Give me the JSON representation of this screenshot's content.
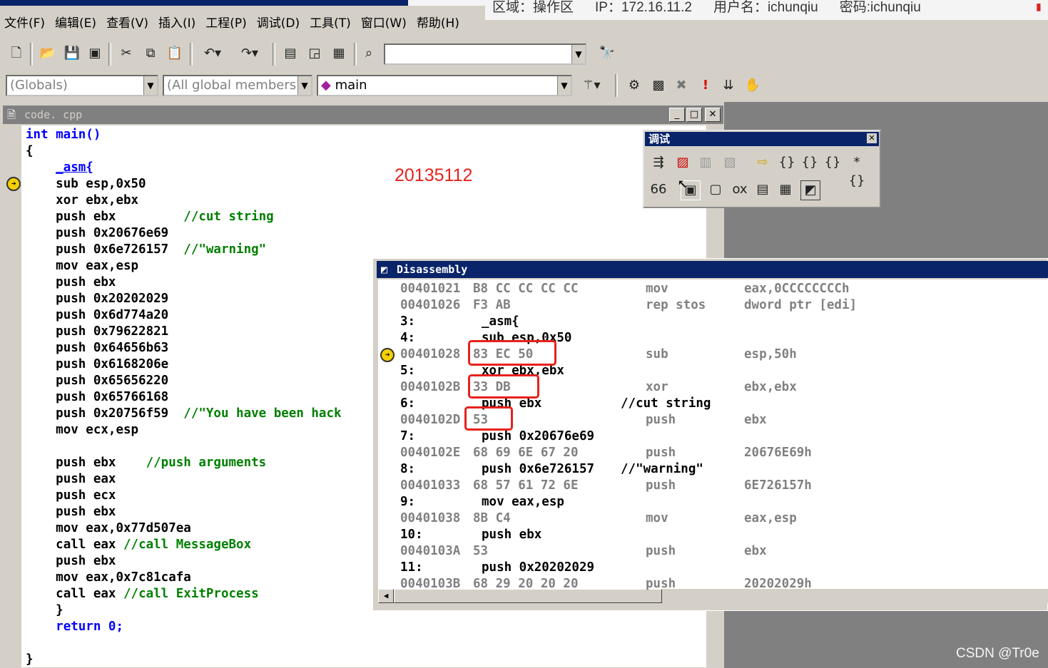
{
  "overlay": {
    "region": "区域：操作区",
    "ip": "IP：172.16.11.2",
    "username": "用户名：ichunqiu",
    "password": "密码:ichunqiu"
  },
  "menu": [
    "文件(F)",
    "编辑(E)",
    "查看(V)",
    "插入(I)",
    "工程(P)",
    "调试(D)",
    "工具(T)",
    "窗口(W)",
    "帮助(H)"
  ],
  "toolbar": {
    "combo_find": "",
    "combo_scope": "(Globals)",
    "combo_members": "(All global members",
    "combo_function": "main"
  },
  "code_window": {
    "title": "code. cpp",
    "lines": [
      {
        "indent": "",
        "code": "int main()",
        "type": "decl"
      },
      {
        "indent": "",
        "code": "{",
        "type": "plain"
      },
      {
        "indent": "    ",
        "code": "_asm{",
        "type": "asm"
      },
      {
        "indent": "    ",
        "code": "sub esp,0x50",
        "type": "plain"
      },
      {
        "indent": "    ",
        "code": "xor ebx,ebx",
        "type": "plain"
      },
      {
        "indent": "    ",
        "code": "push ebx",
        "comment": "//cut string",
        "pad": "         "
      },
      {
        "indent": "    ",
        "code": "push 0x20676e69",
        "type": "plain"
      },
      {
        "indent": "    ",
        "code": "push 0x6e726157",
        "comment": "//\"warning\"",
        "pad": "  "
      },
      {
        "indent": "    ",
        "code": "mov eax,esp",
        "type": "plain"
      },
      {
        "indent": "    ",
        "code": "push ebx",
        "type": "plain"
      },
      {
        "indent": "    ",
        "code": "push 0x20202029",
        "type": "plain"
      },
      {
        "indent": "    ",
        "code": "push 0x6d774a20",
        "type": "plain"
      },
      {
        "indent": "    ",
        "code": "push 0x79622821",
        "type": "plain"
      },
      {
        "indent": "    ",
        "code": "push 0x64656b63",
        "type": "plain"
      },
      {
        "indent": "    ",
        "code": "push 0x6168206e",
        "type": "plain"
      },
      {
        "indent": "    ",
        "code": "push 0x65656220",
        "type": "plain"
      },
      {
        "indent": "    ",
        "code": "push 0x65766168",
        "type": "plain"
      },
      {
        "indent": "    ",
        "code": "push 0x20756f59",
        "comment": "//\"You have been hack",
        "pad": "  "
      },
      {
        "indent": "    ",
        "code": "mov ecx,esp",
        "type": "plain"
      },
      {
        "indent": "",
        "code": "",
        "type": "plain"
      },
      {
        "indent": "    ",
        "code": "push ebx",
        "comment": "//push arguments",
        "pad": "    "
      },
      {
        "indent": "    ",
        "code": "push eax",
        "type": "plain"
      },
      {
        "indent": "    ",
        "code": "push ecx",
        "type": "plain"
      },
      {
        "indent": "    ",
        "code": "push ebx",
        "type": "plain"
      },
      {
        "indent": "    ",
        "code": "mov eax,0x77d507ea",
        "type": "plain"
      },
      {
        "indent": "    ",
        "code": "call eax",
        "comment": "//call MessageBox",
        "pad": " "
      },
      {
        "indent": "    ",
        "code": "push ebx",
        "type": "plain"
      },
      {
        "indent": "    ",
        "code": "mov eax,0x7c81cafa",
        "type": "plain"
      },
      {
        "indent": "    ",
        "code": "call eax",
        "comment": "//call ExitProcess",
        "pad": " "
      },
      {
        "indent": "    ",
        "code": "}",
        "type": "plain"
      },
      {
        "indent": "    ",
        "code": "return 0;",
        "type": "ret"
      },
      {
        "indent": "",
        "code": "",
        "type": "plain"
      },
      {
        "indent": "",
        "code": "}",
        "type": "plain"
      }
    ]
  },
  "annotation": "20135112",
  "debug_toolbar": {
    "title": "调试"
  },
  "disassembly": {
    "title": "Disassembly",
    "lines": [
      {
        "kind": "asm",
        "addr": "00401021",
        "bytes": "B8 CC CC CC CC",
        "mnem": "mov",
        "ops": "eax,0CCCCCCCCh"
      },
      {
        "kind": "asm",
        "addr": "00401026",
        "bytes": "F3 AB",
        "mnem": "rep stos",
        "ops": "dword ptr [edi]"
      },
      {
        "kind": "src",
        "num": "3:",
        "src": "_asm{"
      },
      {
        "kind": "src",
        "num": "4:",
        "src": "sub esp,0x50"
      },
      {
        "kind": "asm",
        "addr": "00401028",
        "bytes": "83 EC 50",
        "mnem": "sub",
        "ops": "esp,50h"
      },
      {
        "kind": "src",
        "num": "5:",
        "src": "xor ebx,ebx"
      },
      {
        "kind": "asm",
        "addr": "0040102B",
        "bytes": "33 DB",
        "mnem": "xor",
        "ops": "ebx,ebx"
      },
      {
        "kind": "src",
        "num": "6:",
        "src": "push ebx",
        "comment": "//cut string"
      },
      {
        "kind": "asm",
        "addr": "0040102D",
        "bytes": "53",
        "mnem": "push",
        "ops": "ebx"
      },
      {
        "kind": "src",
        "num": "7:",
        "src": "push 0x20676e69"
      },
      {
        "kind": "asm",
        "addr": "0040102E",
        "bytes": "68 69 6E 67 20",
        "mnem": "push",
        "ops": "20676E69h"
      },
      {
        "kind": "src",
        "num": "8:",
        "src": "push 0x6e726157",
        "comment": "//\"warning\""
      },
      {
        "kind": "asm",
        "addr": "00401033",
        "bytes": "68 57 61 72 6E",
        "mnem": "push",
        "ops": "6E726157h"
      },
      {
        "kind": "src",
        "num": "9:",
        "src": "mov eax,esp"
      },
      {
        "kind": "asm",
        "addr": "00401038",
        "bytes": "8B C4",
        "mnem": "mov",
        "ops": "eax,esp"
      },
      {
        "kind": "src",
        "num": "10:",
        "src": "push ebx"
      },
      {
        "kind": "asm",
        "addr": "0040103A",
        "bytes": "53",
        "mnem": "push",
        "ops": "ebx"
      },
      {
        "kind": "src",
        "num": "11:",
        "src": "push 0x20202029"
      },
      {
        "kind": "asm",
        "addr": "0040103B",
        "bytes": "68 29 20 20 20",
        "mnem": "push",
        "ops": "20202029h"
      }
    ]
  },
  "watermark": "CSDN @Tr0e",
  "colors": {
    "highlight": "#e8211c",
    "keyword": "#0000ff",
    "comment": "#008000",
    "titlebar": "#0a246a"
  }
}
